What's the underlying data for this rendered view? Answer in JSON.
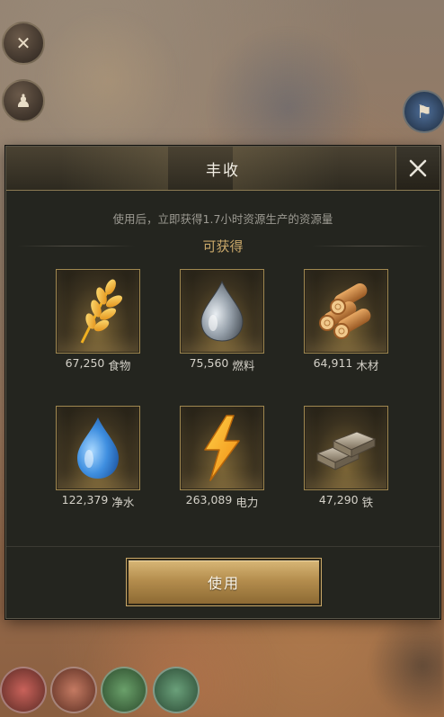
{
  "dialog": {
    "title": "丰收",
    "description": "使用后，立即获得1.7小时资源生产的资源量",
    "section_title": "可获得",
    "use_button_label": "使用"
  },
  "resources": [
    {
      "amount": "67,250",
      "name": "食物",
      "icon": "wheat-icon"
    },
    {
      "amount": "75,560",
      "name": "燃料",
      "icon": "oil-drop-icon"
    },
    {
      "amount": "64,911",
      "name": "木材",
      "icon": "wood-logs-icon"
    },
    {
      "amount": "122,379",
      "name": "净水",
      "icon": "water-drop-icon"
    },
    {
      "amount": "263,089",
      "name": "电力",
      "icon": "lightning-icon"
    },
    {
      "amount": "47,290",
      "name": "铁",
      "icon": "iron-ingot-icon"
    }
  ],
  "colors": {
    "accent_gold": "#c9a86a",
    "panel_bg": "#24251f",
    "button_gold": "#b58e4e"
  }
}
